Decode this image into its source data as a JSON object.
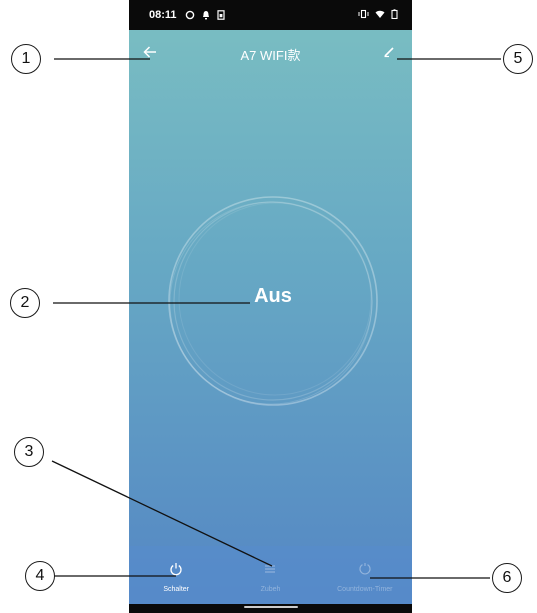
{
  "status_bar": {
    "time": "08:11"
  },
  "app_bar": {
    "title": "A7 WIFI款",
    "back_icon": "arrow-left-icon",
    "edit_icon": "pencil-icon"
  },
  "main": {
    "power_state": "Aus"
  },
  "tabs": [
    {
      "label": "Schalter",
      "icon": "power-icon",
      "active": true
    },
    {
      "label": "Zubeh",
      "icon": "menu-lines-icon",
      "active": false
    },
    {
      "label": "Countdown-Timer",
      "icon": "timer-icon",
      "active": false
    }
  ],
  "callouts": [
    "1",
    "2",
    "3",
    "4",
    "5",
    "6"
  ],
  "colors": {
    "gradient_top": "#7bbfc2",
    "gradient_bottom": "#5486c4",
    "status_bar": "#0a0a0a"
  }
}
